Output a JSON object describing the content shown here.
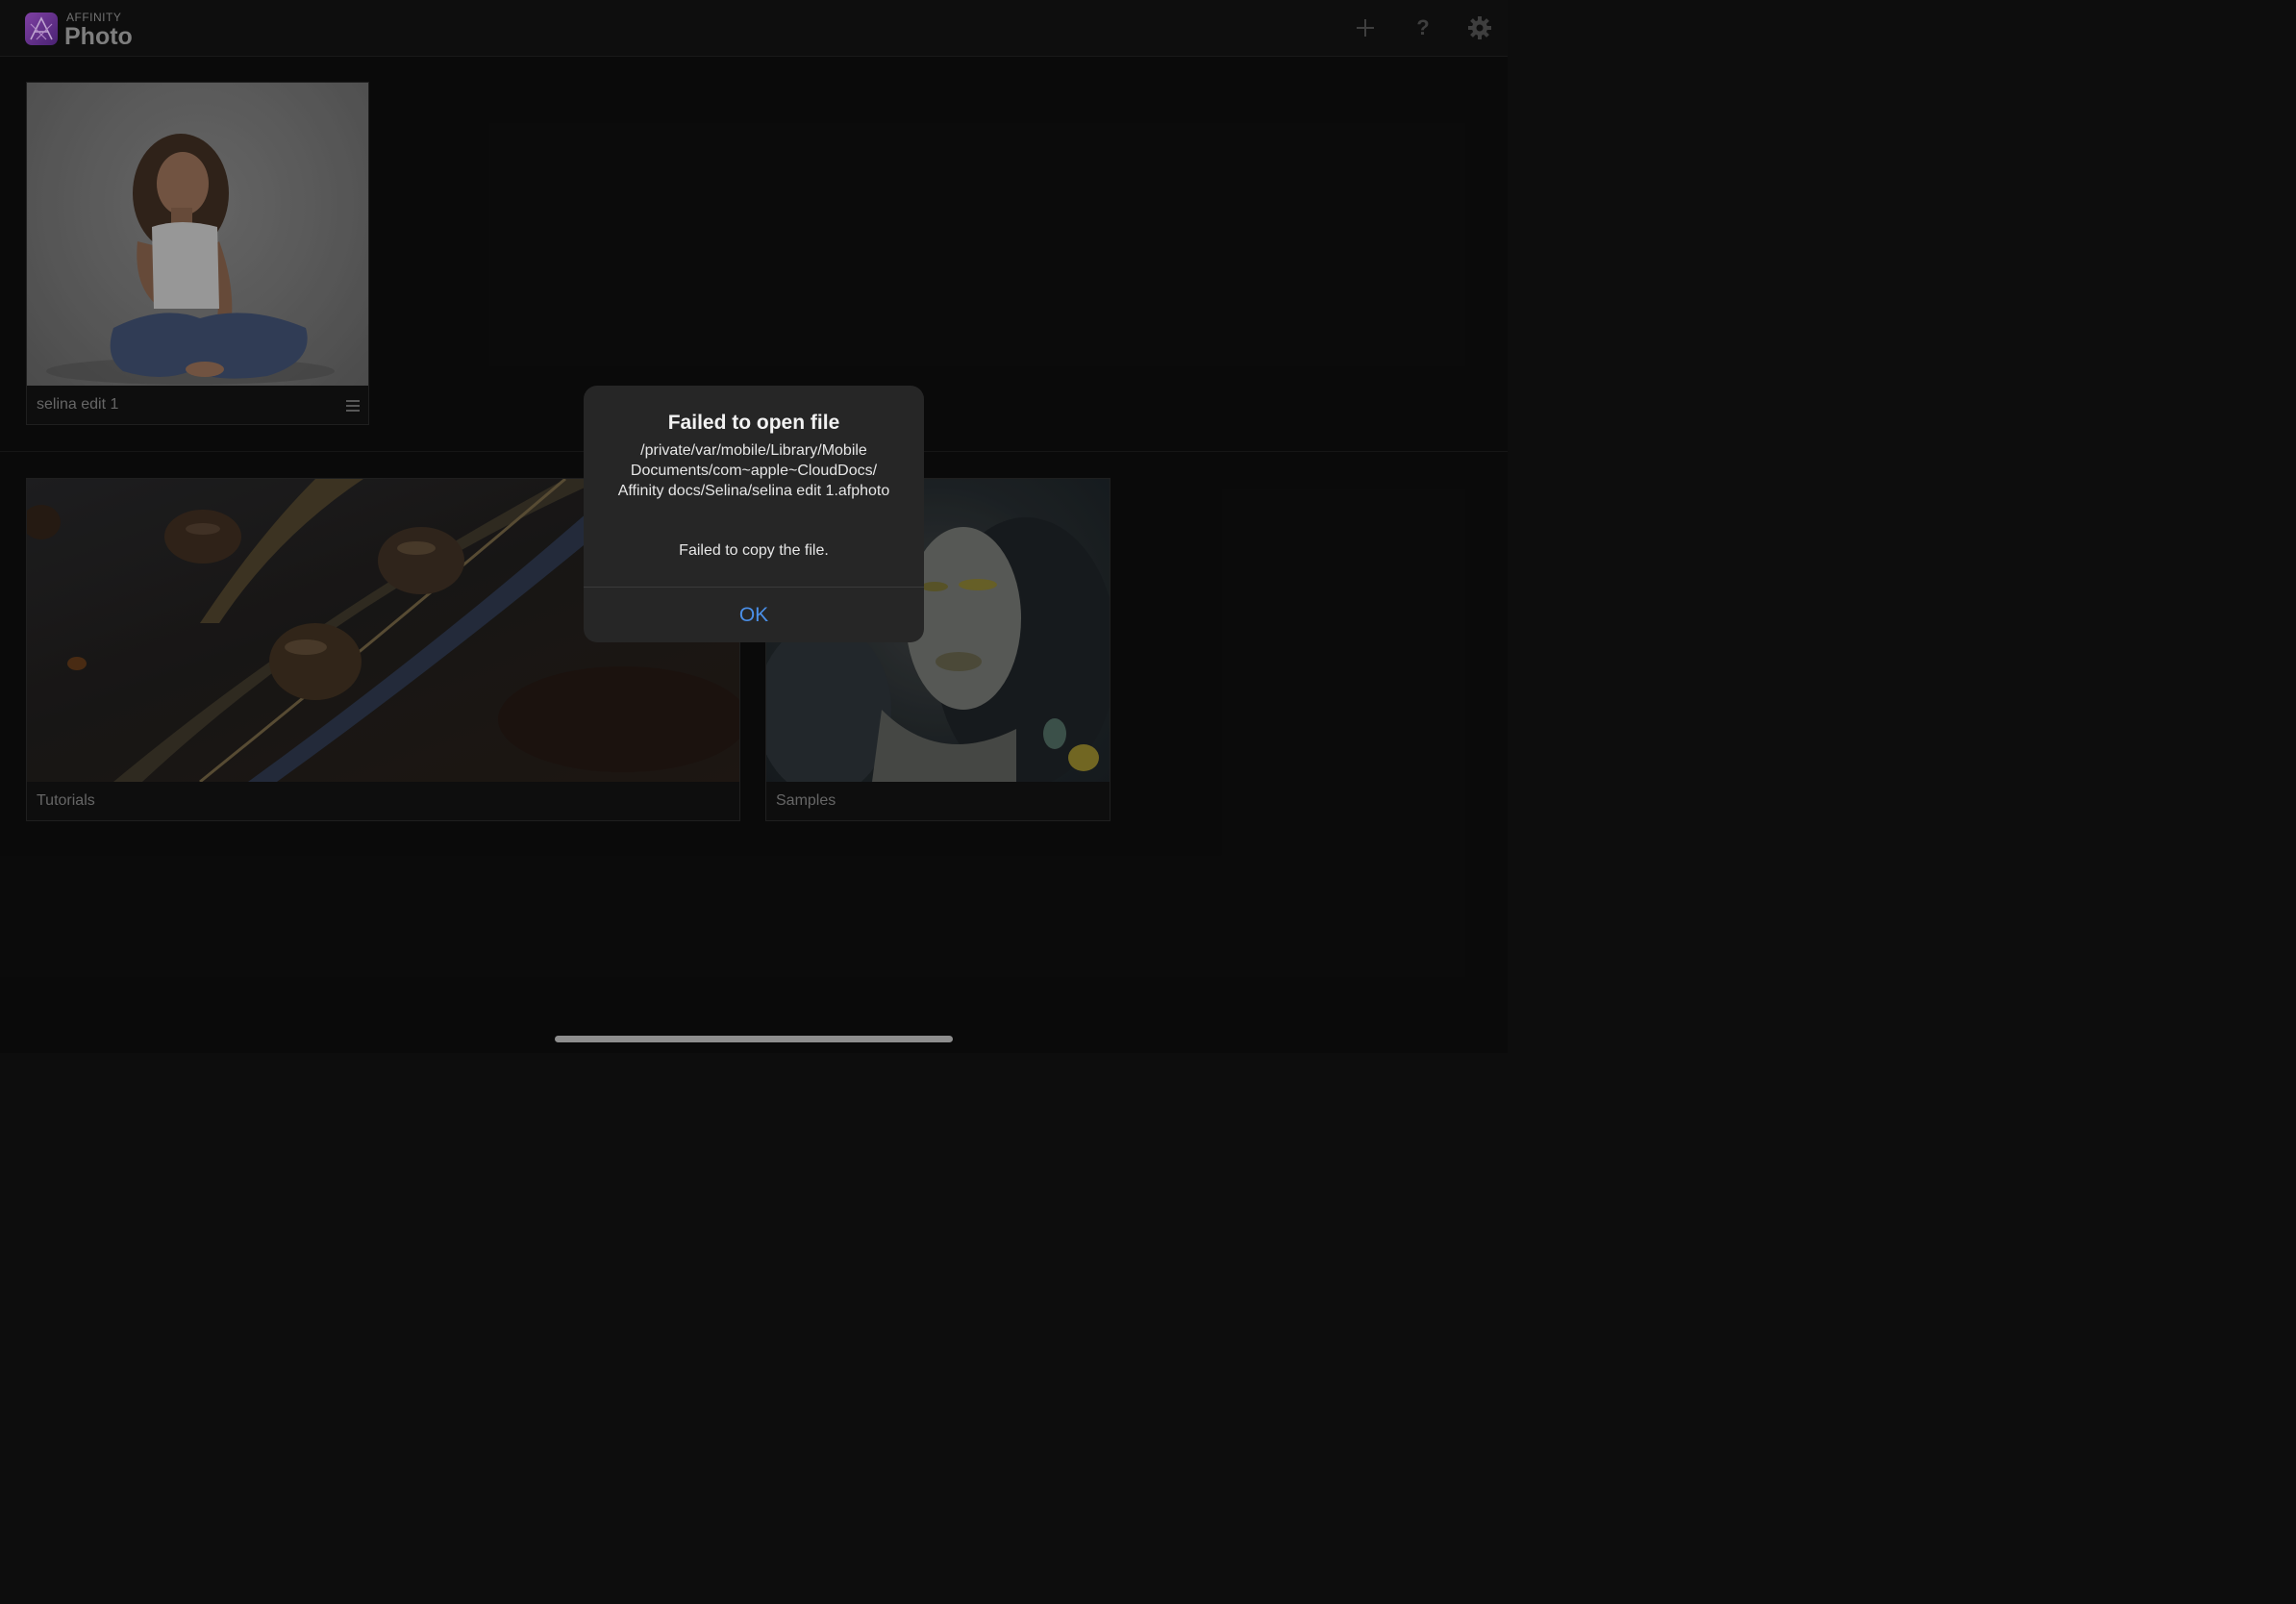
{
  "app": {
    "brand_small": "AFFINITY",
    "brand_name": "Photo",
    "accent": "#8e44ad"
  },
  "toolbar": {
    "add_icon": "plus-icon",
    "help_label": "?",
    "settings_icon": "gear-icon"
  },
  "documents": [
    {
      "name": "selina edit 1",
      "menu_icon": "hamburger-icon"
    }
  ],
  "sections": [
    {
      "label": "Tutorials"
    },
    {
      "label": "Samples"
    }
  ],
  "dialog": {
    "title": "Failed to open file",
    "path": "/private/var/mobile/Library/Mobile Documents/com~apple~CloudDocs/ Affinity docs/Selina/selina edit 1.afphoto",
    "message": "Failed to copy the file.",
    "ok_label": "OK",
    "button_color": "#4a8fe8"
  }
}
